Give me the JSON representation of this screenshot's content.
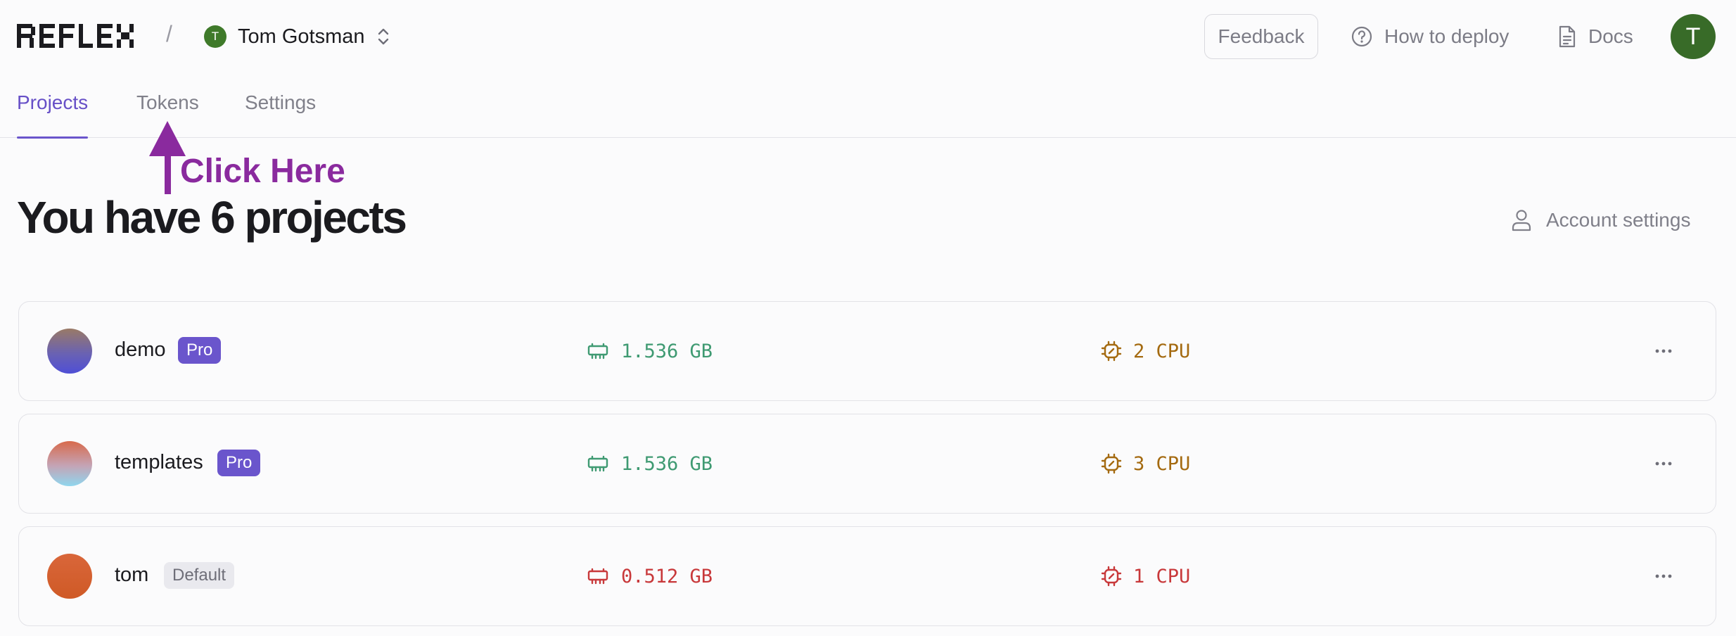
{
  "header": {
    "logo_text": "REFLEX",
    "separator": "/",
    "team": {
      "initial": "T",
      "name": "Tom Gotsman"
    },
    "feedback_label": "Feedback",
    "deploy_label": "How to deploy",
    "docs_label": "Docs",
    "user_initial": "T"
  },
  "tabs": [
    {
      "label": "Projects",
      "active": true
    },
    {
      "label": "Tokens",
      "active": false
    },
    {
      "label": "Settings",
      "active": false
    }
  ],
  "annotation": {
    "text": "Click Here",
    "color": "#8a2a9e"
  },
  "main": {
    "title": "You have 6 projects",
    "account_settings_label": "Account settings"
  },
  "projects": [
    {
      "name": "demo",
      "badge": "Pro",
      "memory": "1.536 GB",
      "cpu": "2 CPU",
      "memory_color": "#3f9a72",
      "cpu_color": "#a46a10"
    },
    {
      "name": "templates",
      "badge": "Pro",
      "memory": "1.536 GB",
      "cpu": "3 CPU",
      "memory_color": "#3f9a72",
      "cpu_color": "#a46a10"
    },
    {
      "name": "tom",
      "badge": "Default",
      "memory": "0.512 GB",
      "cpu": "1 CPU",
      "memory_color": "#c8383a",
      "cpu_color": "#c8383a"
    }
  ],
  "colors": {
    "accent": "#6a55cc",
    "pro_badge": "#6a55cc",
    "default_badge": "#e9e9ee",
    "avatar_green": "#386b28"
  }
}
